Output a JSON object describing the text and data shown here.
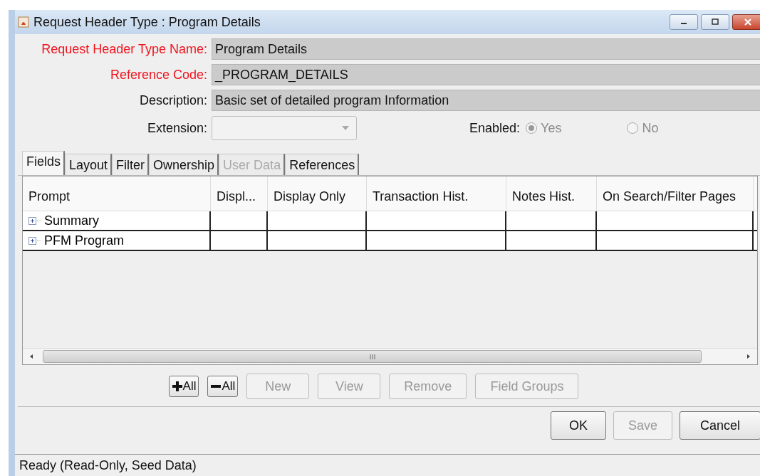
{
  "window": {
    "title": "Request Header Type : Program Details"
  },
  "fields": [
    {
      "label": "Request Header Type Name:",
      "value": "Program Details",
      "required": true
    },
    {
      "label": "Reference Code:",
      "value": "_PROGRAM_DETAILS",
      "required": true
    },
    {
      "label": "Description:",
      "value": "Basic set of detailed program Information",
      "required": false
    }
  ],
  "extension": {
    "label": "Extension:",
    "disabled": true
  },
  "enabled": {
    "label": "Enabled:",
    "options": [
      {
        "label": "Yes",
        "selected": true
      },
      {
        "label": "No",
        "selected": false
      }
    ]
  },
  "tabs": [
    {
      "label": "Fields",
      "selected": true,
      "disabled": false
    },
    {
      "label": "Layout",
      "selected": false,
      "disabled": false
    },
    {
      "label": "Filter",
      "selected": false,
      "disabled": false
    },
    {
      "label": "Ownership",
      "selected": false,
      "disabled": false
    },
    {
      "label": "User Data",
      "selected": false,
      "disabled": true
    },
    {
      "label": "References",
      "selected": false,
      "disabled": false
    }
  ],
  "table": {
    "columns": [
      "Prompt",
      "Displ...",
      "Display Only",
      "Transaction Hist.",
      "Notes Hist.",
      "On Search/Filter Pages"
    ],
    "rows": [
      {
        "label": "Summary",
        "expanded": false
      },
      {
        "label": "PFM Program",
        "expanded": false
      }
    ]
  },
  "table_buttons": [
    {
      "kind": "expand",
      "label": "All",
      "disabled": false
    },
    {
      "kind": "collapse",
      "label": "All",
      "disabled": false
    },
    {
      "kind": "text",
      "label": "New",
      "disabled": true
    },
    {
      "kind": "text",
      "label": "View",
      "disabled": true
    },
    {
      "kind": "text",
      "label": "Remove",
      "disabled": true
    },
    {
      "kind": "text",
      "label": "Field Groups",
      "disabled": true
    }
  ],
  "dialog_buttons": [
    {
      "label": "OK",
      "disabled": false
    },
    {
      "label": "Save",
      "disabled": true
    },
    {
      "label": "Cancel",
      "disabled": false
    }
  ],
  "status_bar": "Ready (Read-Only, Seed Data)"
}
